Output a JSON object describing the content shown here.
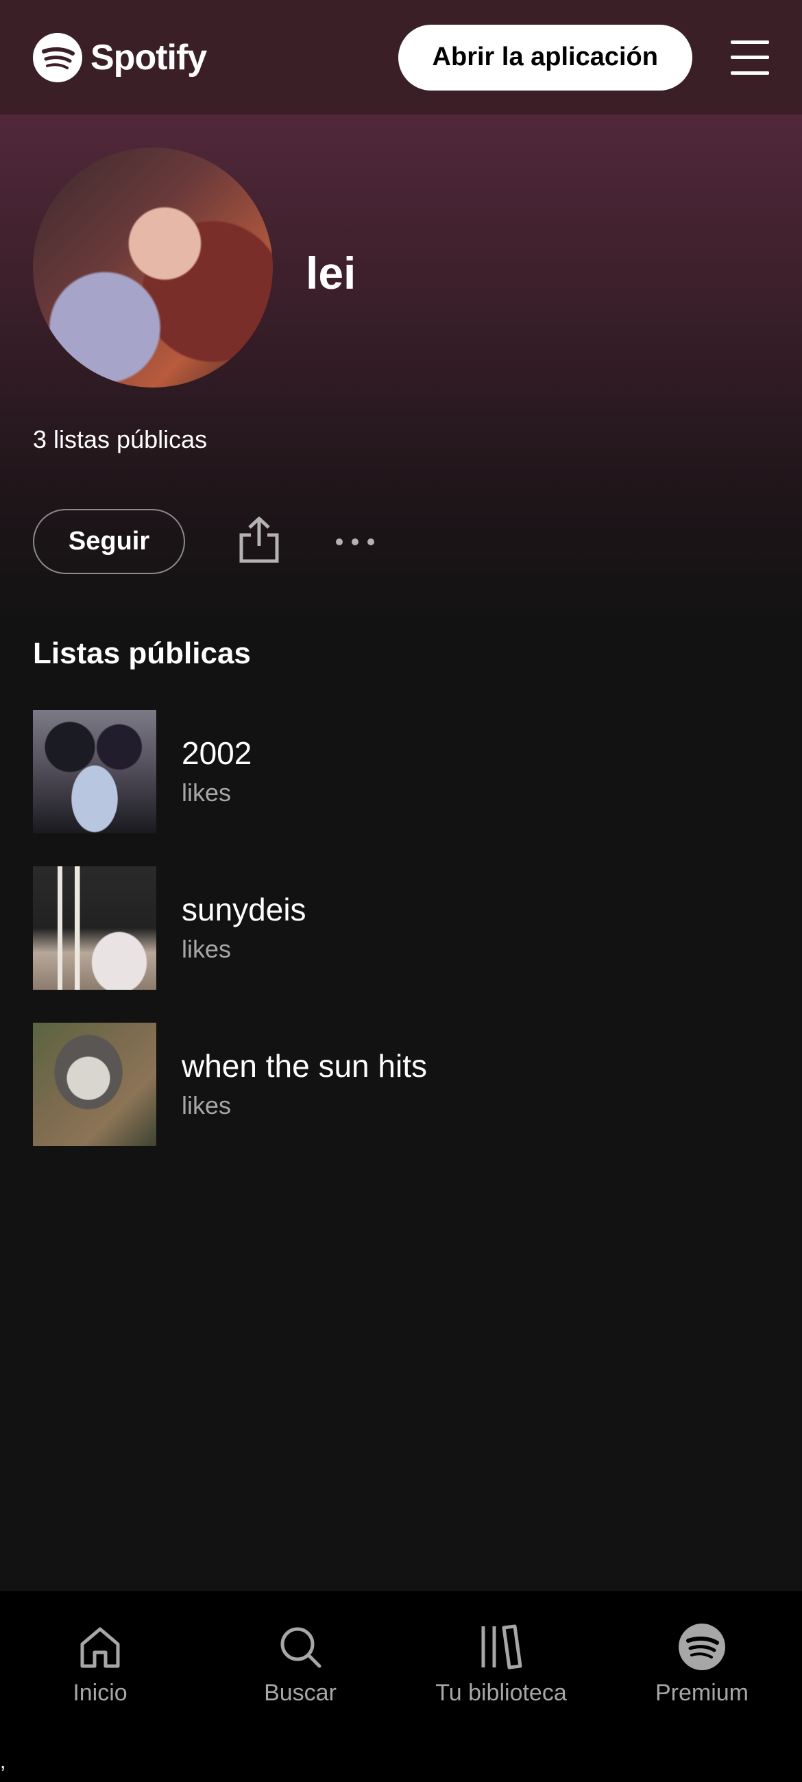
{
  "header": {
    "brand": "Spotify",
    "open_app_label": "Abrir la aplicación",
    "logo_icon": "spotify-logo-icon",
    "menu_icon": "hamburger-menu-icon"
  },
  "profile": {
    "name": "lei",
    "public_count": "3 listas públicas"
  },
  "actions": {
    "follow_label": "Seguir",
    "share_icon": "share-icon",
    "more_icon": "more-options-icon"
  },
  "section": {
    "title": "Listas públicas"
  },
  "playlists": [
    {
      "name": "2002",
      "subtitle": "likes"
    },
    {
      "name": "sunydeis",
      "subtitle": "likes"
    },
    {
      "name": "when the sun hits",
      "subtitle": "likes"
    }
  ],
  "bottom_nav": [
    {
      "label": "Inicio",
      "icon": "home-icon"
    },
    {
      "label": "Buscar",
      "icon": "search-icon"
    },
    {
      "label": "Tu biblioteca",
      "icon": "library-icon"
    },
    {
      "label": "Premium",
      "icon": "spotify-premium-icon"
    }
  ],
  "footer": {
    "stray_mark": ","
  },
  "colors": {
    "header_bg": "#3a1f27",
    "hero_top": "#51283a",
    "page_bg": "#121212",
    "nav_bg": "#000000",
    "muted_text": "#a7a7a7"
  }
}
